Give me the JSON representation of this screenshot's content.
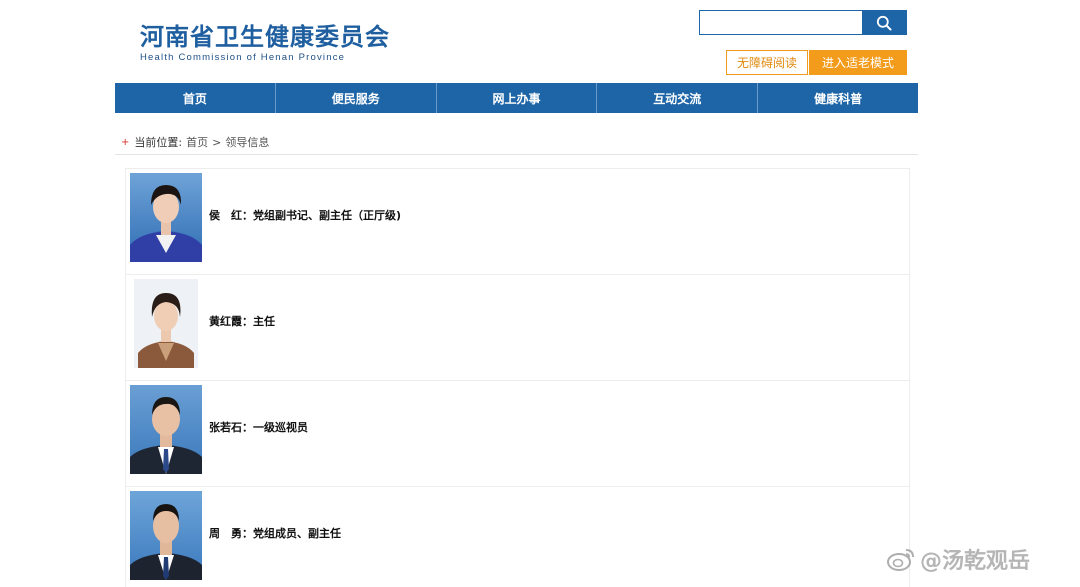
{
  "header": {
    "logo_cn": "河南省卫生健康委员会",
    "logo_en": "Health Commission of Henan Province"
  },
  "search": {
    "placeholder": "",
    "icon": "search-icon"
  },
  "top_buttons": {
    "accessibility": "无障碍阅读",
    "elder_mode": "进入适老模式"
  },
  "nav": [
    "首页",
    "便民服务",
    "网上办事",
    "互动交流",
    "健康科普"
  ],
  "breadcrumb": {
    "label": "当前位置:",
    "home": "首页",
    "separator": ">",
    "current": "领导信息"
  },
  "leaders": [
    {
      "name": "侯　红",
      "title": "党组副书记、副主任（正厅级)",
      "sep": "："
    },
    {
      "name": "黄红霞",
      "title": "主任",
      "sep": "："
    },
    {
      "name": "张若石",
      "title": "一级巡视员",
      "sep": "："
    },
    {
      "name": "周　勇",
      "title": "党组成员、副主任",
      "sep": "："
    }
  ],
  "watermark": "@汤乾观岳",
  "colors": {
    "brand_blue": "#1e65a7",
    "accent_orange": "#f39b1b"
  }
}
